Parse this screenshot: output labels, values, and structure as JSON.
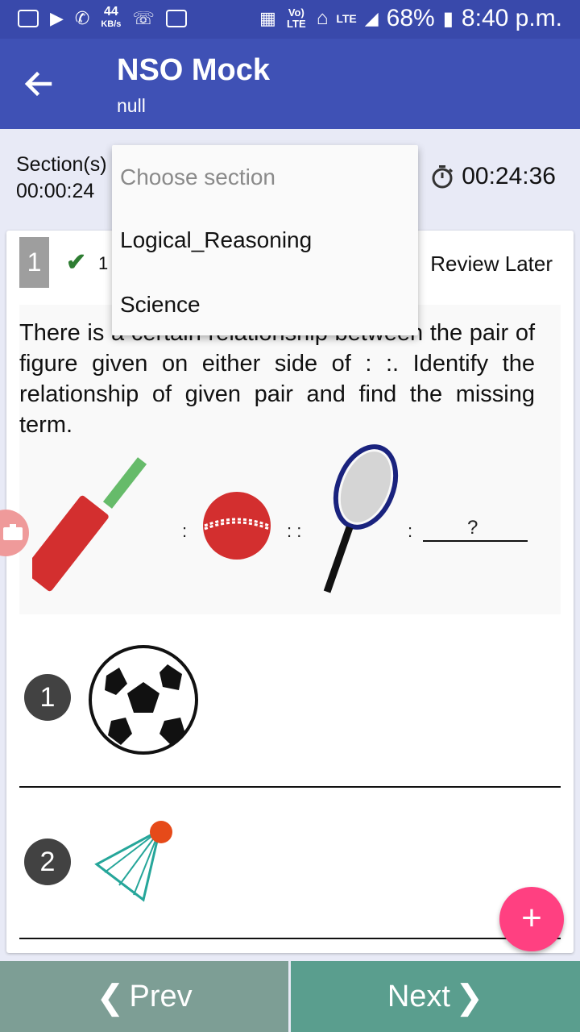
{
  "status_bar": {
    "net_speed": "44",
    "net_unit": "KB/s",
    "volte": "Vo) LTE",
    "lte": "LTE",
    "battery": "68%",
    "time": "8:40 p.m."
  },
  "app_bar": {
    "title": "NSO Mock",
    "subtitle": "null"
  },
  "info_bar": {
    "section_label": "Section(s)",
    "section_time": "00:00:24",
    "total_timer": "00:24:36"
  },
  "question": {
    "number": "1",
    "partial_label": "1",
    "review_label": "Review Later",
    "text": "There is a certain relationship between the pair of figure given on either side of : :. Identify the relationship of given pair and find the missing term.",
    "figure_missing": "?"
  },
  "options": [
    {
      "number": "1",
      "image": "football"
    },
    {
      "number": "2",
      "image": "shuttlecock"
    }
  ],
  "dropdown": {
    "placeholder": "Choose section",
    "items": [
      "Logical_Reasoning",
      "Science"
    ]
  },
  "fab": {
    "label": "+"
  },
  "nav": {
    "prev": "Prev",
    "next": "Next"
  },
  "colors": {
    "app_bar": "#3f51b5",
    "status_bar": "#3949ab",
    "prev": "#7d9e95",
    "next": "#5a9e8e",
    "fab": "#ff4081"
  }
}
